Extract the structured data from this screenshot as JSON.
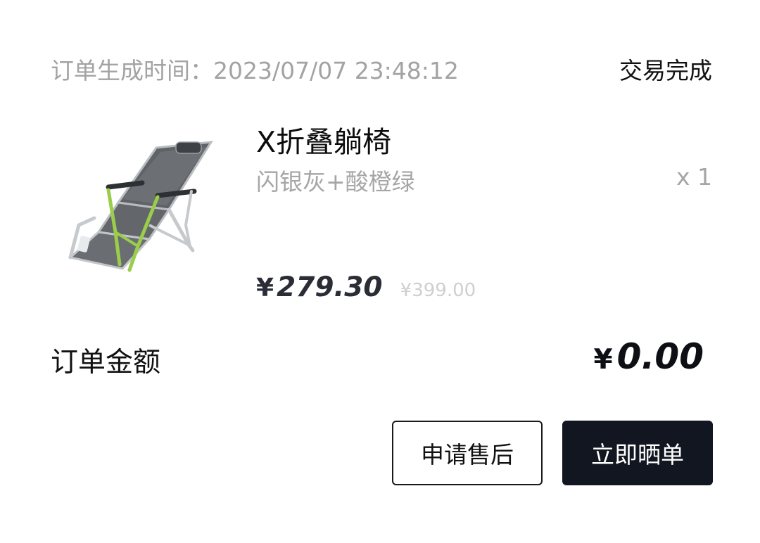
{
  "order": {
    "time_label": "订单生成时间：",
    "time_value": "2023/07/07 23:48:12",
    "status": "交易完成"
  },
  "product": {
    "icon": "folding-lounge-chair-image",
    "title": "X折叠躺椅",
    "spec": "闪银灰+酸橙绿",
    "quantity": "x 1",
    "currency": "¥",
    "price": "279.30",
    "original_price": "¥399.00"
  },
  "total": {
    "label": "订单金额",
    "currency": "¥",
    "amount": "0.00"
  },
  "actions": {
    "after_sale_label": "申请售后",
    "share_review_label": "立即晒单"
  },
  "colors": {
    "accent_dark": "#121620",
    "muted_text": "#a3a3a3",
    "chair_frame_green": "#9acd4a",
    "chair_fabric": "#6c6f73"
  }
}
